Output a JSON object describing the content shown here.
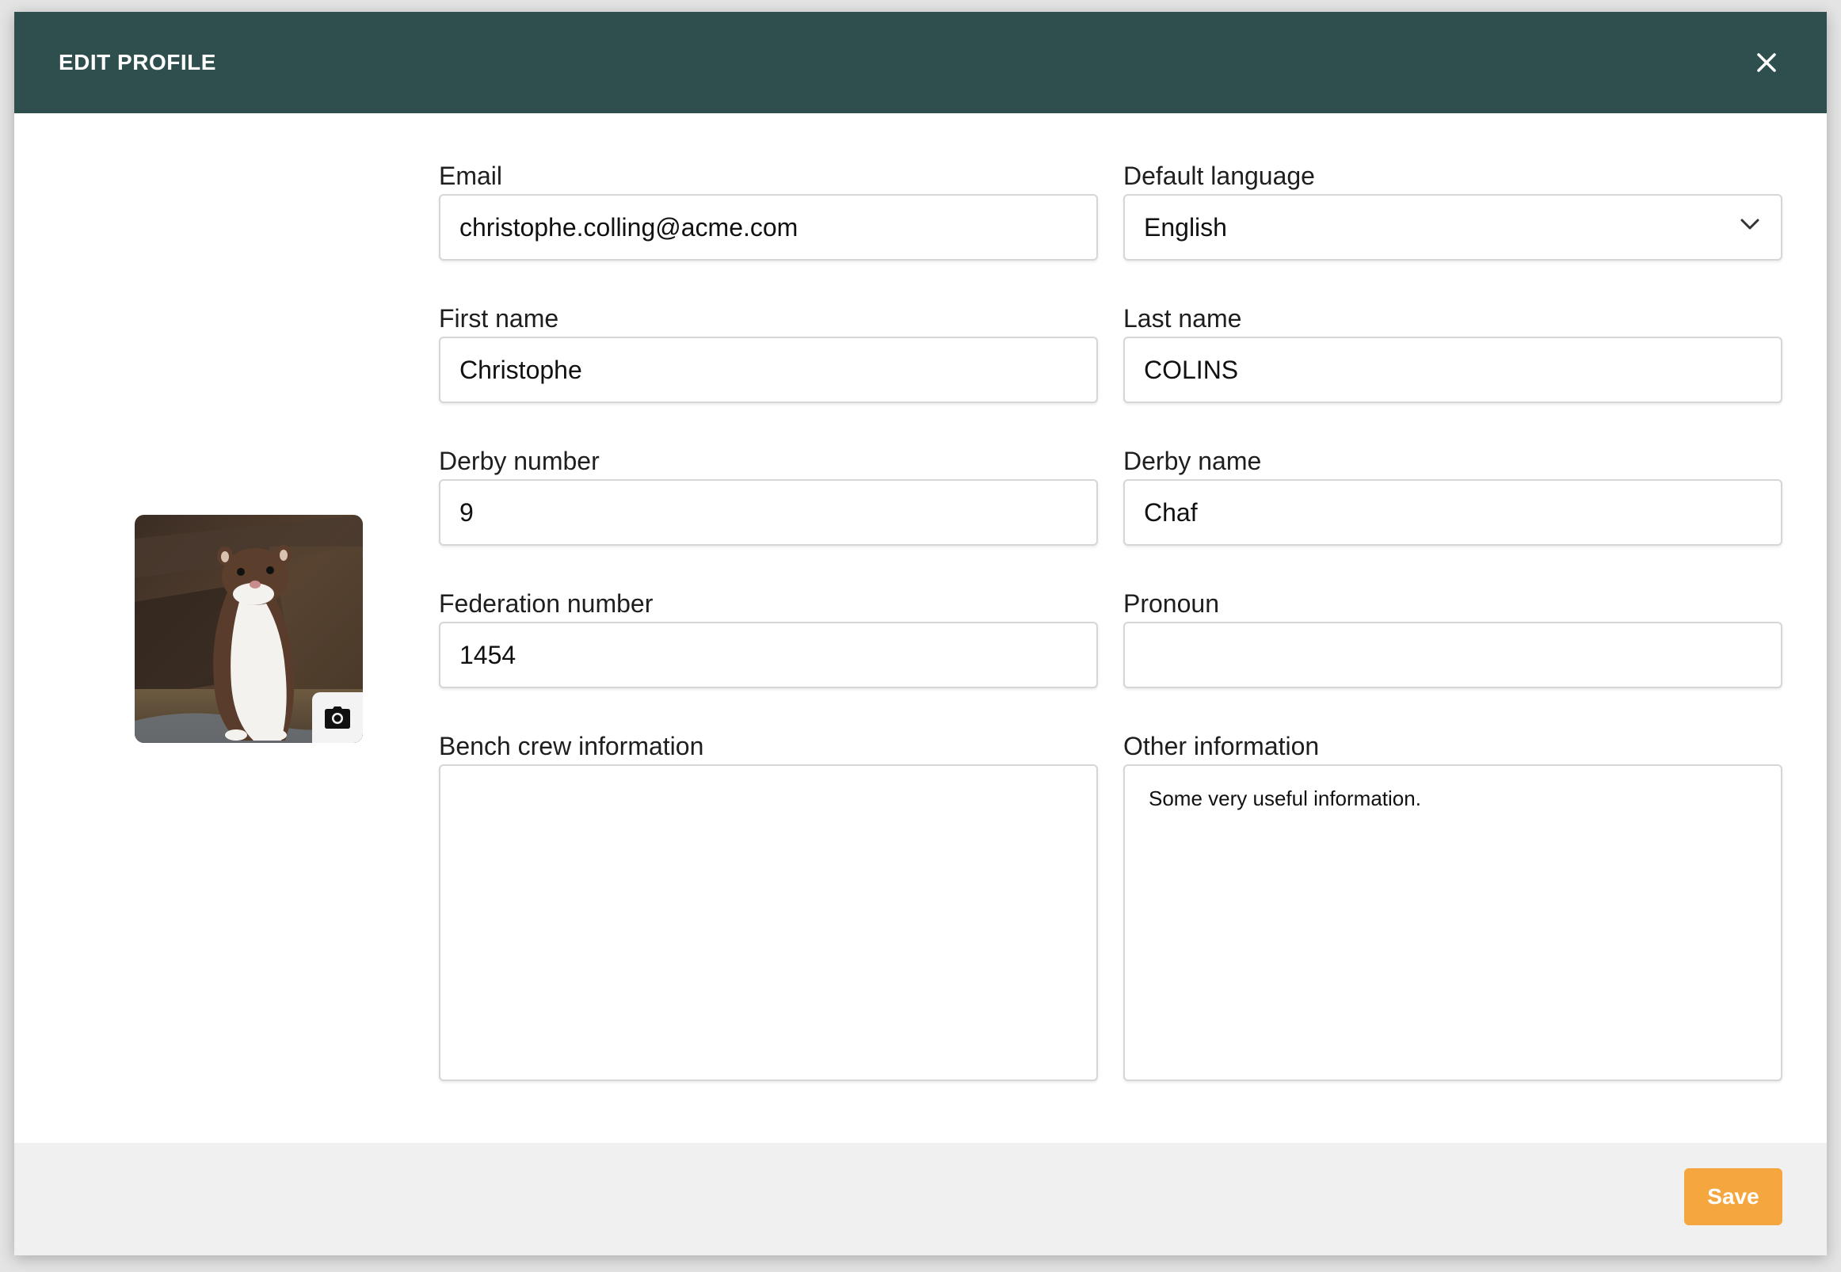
{
  "modal": {
    "title": "EDIT PROFILE"
  },
  "fields": {
    "email": {
      "label": "Email",
      "value": "christophe.colling@acme.com"
    },
    "language": {
      "label": "Default language",
      "value": "English"
    },
    "first_name": {
      "label": "First name",
      "value": "Christophe"
    },
    "last_name": {
      "label": "Last name",
      "value": "COLINS"
    },
    "derby_number": {
      "label": "Derby number",
      "value": "9"
    },
    "derby_name": {
      "label": "Derby name",
      "value": "Chaf"
    },
    "federation_number": {
      "label": "Federation number",
      "value": "1454"
    },
    "pronoun": {
      "label": "Pronoun",
      "value": ""
    },
    "bench_crew": {
      "label": "Bench crew information",
      "value": ""
    },
    "other_info": {
      "label": "Other information",
      "value": "Some very useful information."
    }
  },
  "footer": {
    "save_label": "Save"
  },
  "colors": {
    "header_bg": "#2f4f4f",
    "save_bg": "#f6a63f",
    "footer_bg": "#f0f0f0"
  },
  "icons": {
    "close": "close-icon",
    "chevron": "chevron-down-icon",
    "camera": "camera-icon",
    "avatar": "ermine-photo"
  }
}
